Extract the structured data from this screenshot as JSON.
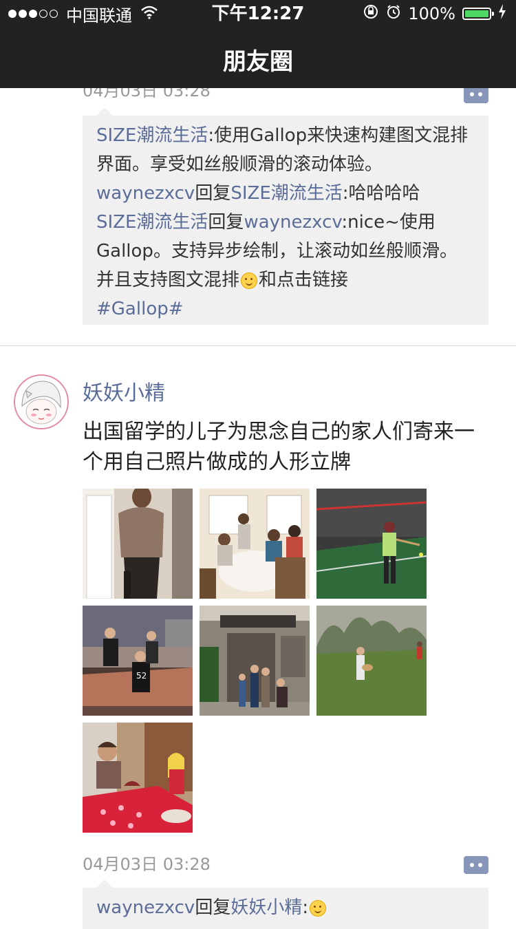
{
  "status_bar": {
    "carrier": "中国联通",
    "time": "下午12:27",
    "battery": "100%"
  },
  "nav": {
    "title": "朋友圈"
  },
  "post1": {
    "time": "04月03日 03:28",
    "comments": [
      {
        "author": "SIZE潮流生活",
        "text": ":使用Gallop来快速构建图文混排界面。享受如丝般顺滑的滚动体验。"
      },
      {
        "author": "waynezxcv",
        "reply_word": "回复",
        "reply_to": "SIZE潮流生活",
        "text": ":哈哈哈哈"
      },
      {
        "author": "SIZE潮流生活",
        "reply_word": "回复",
        "reply_to": "waynezxcv",
        "text_a": ":nice~使用Gallop。支持异步绘制，让滚动如丝般顺滑。并且支持图文混排",
        "text_b": "和点击链接",
        "hashtag": "#Gallop#"
      }
    ]
  },
  "post2": {
    "username": "妖妖小精",
    "content": "出国留学的儿子为思念自己的家人们寄来一个用自己照片做成的人形立牌",
    "photos": [
      "photo-1",
      "photo-2",
      "photo-3",
      "photo-4",
      "photo-5",
      "photo-6",
      "photo-7"
    ],
    "time": "04月03日 03:28",
    "comments": [
      {
        "author": "waynezxcv",
        "reply_word": "回复",
        "reply_to": "妖妖小精",
        "text": ":"
      }
    ]
  },
  "colors": {
    "nav_bg": "#222222",
    "link": "#5b6c98",
    "comment_bg": "#f0f0f0",
    "more_button": "#8796b8"
  }
}
